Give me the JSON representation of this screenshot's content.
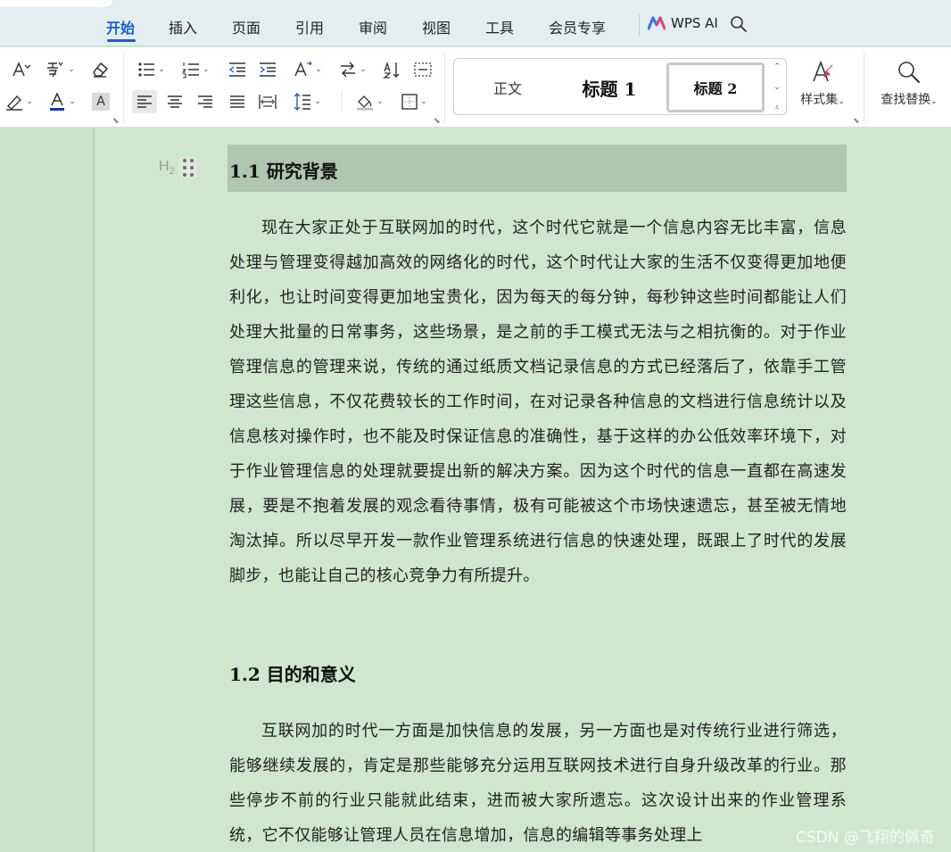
{
  "menu": {
    "tabs": [
      "开始",
      "插入",
      "页面",
      "引用",
      "审阅",
      "视图",
      "工具",
      "会员专享"
    ],
    "active_tab": 0,
    "ai_label": "WPS AI"
  },
  "ribbon": {
    "char_glyph": "A",
    "shade_glyph": "A",
    "styles": {
      "normal": "正文",
      "heading1": "标题 1",
      "heading2": "标题 2",
      "style_set_label": "样式集"
    },
    "find_replace_label": "查找替换",
    "colors": {
      "font_color_bar": "#1b2fd0",
      "accent": "#1a5fd1"
    }
  },
  "document": {
    "heading_marker": "H",
    "heading_marker_level": "2",
    "section1_heading": "1.1  研究背景",
    "section1_para": "现在大家正处于互联网加的时代，这个时代它就是一个信息内容无比丰富，信息处理与管理变得越加高效的网络化的时代，这个时代让大家的生活不仅变得更加地便利化，也让时间变得更加地宝贵化，因为每天的每分钟，每秒钟这些时间都能让人们处理大批量的日常事务，这些场景，是之前的手工模式无法与之相抗衡的。对于作业管理信息的管理来说，传统的通过纸质文档记录信息的方式已经落后了，依靠手工管理这些信息，不仅花费较长的工作时间，在对记录各种信息的文档进行信息统计以及信息核对操作时，也不能及时保证信息的准确性，基于这样的办公低效率环境下，对于作业管理信息的处理就要提出新的解决方案。因为这个时代的信息一直都在高速发展，要是不抱着发展的观念看待事情，极有可能被这个市场快速遗忘，甚至被无情地淘汰掉。所以尽早开发一款作业管理系统进行信息的快速处理，既跟上了时代的发展脚步，也能让自己的核心竞争力有所提升。",
    "section2_heading": "1.2 目的和意义",
    "section2_para": "互联网加的时代一方面是加快信息的发展，另一方面也是对传统行业进行筛选，能够继续发展的，肯定是那些能够充分运用互联网技术进行自身升级改革的行业。那些停步不前的行业只能就此结束，进而被大家所遗忘。这次设计出来的作业管理系统，它不仅能够让管理人员在信息增加，信息的编辑等事务处理上"
  },
  "watermark": "CSDN @飞翔的佩奇"
}
